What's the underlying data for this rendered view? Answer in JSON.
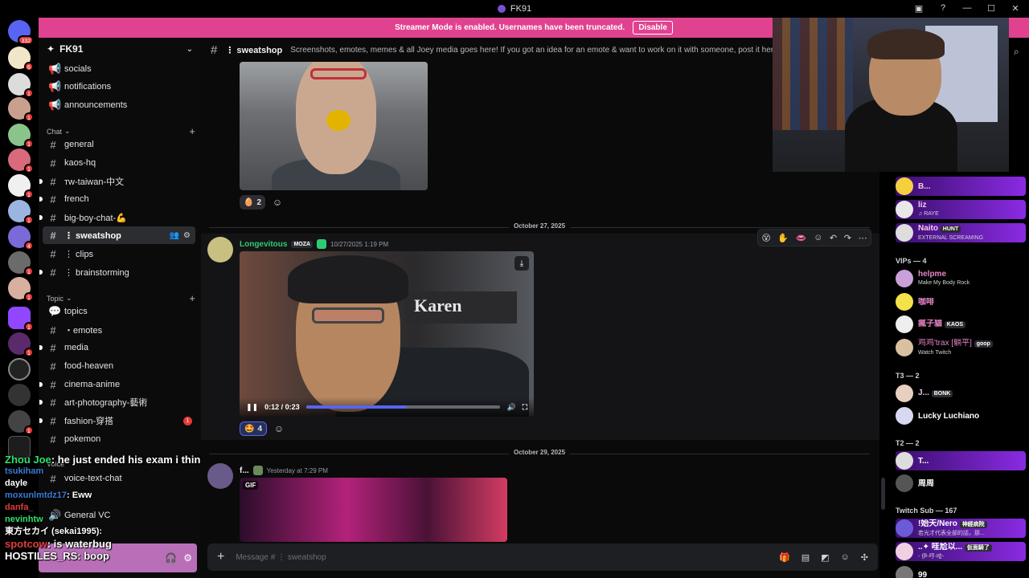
{
  "window": {
    "title": "FK91"
  },
  "banner": {
    "text": "Streamer Mode is enabled. Usernames have been truncated.",
    "disable_label": "Disable",
    "color": "#e0428f"
  },
  "rail": {
    "badges": [
      "332",
      "6",
      "1",
      "1",
      "1",
      "1",
      "1",
      "1",
      "4",
      "1",
      "1",
      "1",
      "1",
      "1",
      "1"
    ]
  },
  "server": {
    "name": "FK91"
  },
  "channels": {
    "top": [
      "socials",
      "notifications",
      "announcements"
    ],
    "chat_category": "Chat",
    "chat": [
      "general",
      "kaos-hq",
      "тw-taiwan-中文",
      "french",
      "big-boy-chat-💪",
      "⋮ sweatshop",
      "⋮ clips",
      "⋮ brainstorming"
    ],
    "topic_category": "Topic",
    "topic": [
      "topics",
      "・emotes",
      "media",
      "food-heaven",
      "cinema-anime",
      "art-photography-藝術",
      "fashion-穿搭",
      "pokemon"
    ],
    "fashion_unread": "1",
    "voice_category": "Voice",
    "voice": [
      "voice-text-chat",
      "General VC"
    ]
  },
  "overlay_chat": [
    {
      "user": "Zhou Joe",
      "text": ": he just ended his exam i think"
    },
    {
      "user": "tsukiham",
      "text": ""
    },
    {
      "user": "dayle",
      "text": ""
    },
    {
      "user": "moxunlmtdz17",
      "text": ": Eww"
    },
    {
      "user": "danfa_",
      "text": ""
    },
    {
      "user": "nevinhtw",
      "text": ""
    },
    {
      "user": "東方セカイ (sekai1995)",
      "text": ":"
    },
    {
      "user": "spotcow",
      "text": ": is waterbug"
    },
    {
      "user": "HOSTILES_RS",
      "text": ": boop"
    }
  ],
  "header": {
    "channel": "⋮ sweatshop",
    "topic": "Screenshots, emotes, memes & all Joey media goes here! If you got an idea for an emote & want to work on it with someone, post it here."
  },
  "messages": {
    "first_reactions": [
      {
        "emoji": "🥚",
        "count": "2"
      }
    ],
    "divider1": "October 27, 2025",
    "msg2": {
      "user": "Longevitous",
      "tag": "MOZA",
      "time": "10/27/2025 1:19 PM",
      "video_time": "0:12 / 0:23",
      "progress": 0.52,
      "sign": "Karen",
      "reactions": [
        {
          "emoji": "🤩",
          "count": "4"
        }
      ]
    },
    "divider2": "October 29, 2025",
    "msg3": {
      "user": "f...",
      "time": "Yesterday at 7:29 PM",
      "gif_label": "GIF"
    }
  },
  "composer": {
    "placeholder": "Message # ⋮ sweatshop"
  },
  "members": {
    "top": [
      {
        "name": "B...",
        "status": ""
      },
      {
        "name": "liz",
        "status": "♫ RAYE"
      },
      {
        "name": "Naito",
        "tag": "HUNT",
        "status": "EXTERNAL SCREAMING"
      }
    ],
    "vips_label": "VIPs — 4",
    "vips": [
      {
        "name": "helpme",
        "status": "Make My Body Rock"
      },
      {
        "name": "咖啡",
        "status": ""
      },
      {
        "name": "瘋子貓",
        "tag": "KAOS",
        "status": ""
      },
      {
        "name": "鸡鸡'trax [躺平]",
        "tag": "goop",
        "status": "Watch Twitch"
      }
    ],
    "t3_label": "T3 — 2",
    "t3": [
      {
        "name": "J...",
        "tag": "BONK"
      },
      {
        "name": "Lucky Luchiano"
      }
    ],
    "t2_label": "T2 — 2",
    "t2": [
      {
        "name": "T..."
      },
      {
        "name": "周周"
      }
    ],
    "sub_label": "Twitch Sub — 167",
    "subs": [
      {
        "name": "!始天/Nero",
        "tag": "神經病院",
        "status": "若光才代表全部的話，那..."
      },
      {
        "name": "..✦ 哇尬以...",
        "tag": "仮面騎了",
        "status": "- 伊-哼-哈-"
      },
      {
        "name": "99"
      }
    ]
  }
}
